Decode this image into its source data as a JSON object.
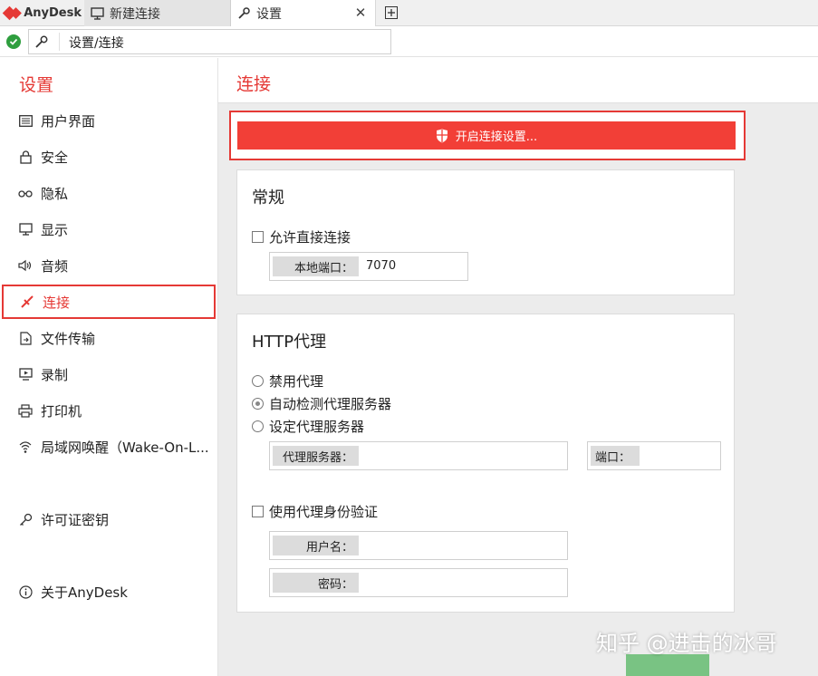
{
  "app": {
    "name": "AnyDesk"
  },
  "tabs": [
    {
      "label": "新建连接",
      "icon": "monitor-icon"
    },
    {
      "label": "设置",
      "icon": "wrench-icon"
    }
  ],
  "address": {
    "path": "设置/连接"
  },
  "sidebar": {
    "title": "设置",
    "items": [
      {
        "label": "用户界面",
        "icon": "ui-icon"
      },
      {
        "label": "安全",
        "icon": "lock-icon"
      },
      {
        "label": "隐私",
        "icon": "glasses-icon"
      },
      {
        "label": "显示",
        "icon": "display-icon"
      },
      {
        "label": "音频",
        "icon": "speaker-icon"
      },
      {
        "label": "连接",
        "icon": "connection-icon"
      },
      {
        "label": "文件传输",
        "icon": "file-transfer-icon"
      },
      {
        "label": "录制",
        "icon": "recording-icon"
      },
      {
        "label": "打印机",
        "icon": "printer-icon"
      },
      {
        "label": "局域网唤醒（Wake-On-L...",
        "icon": "wifi-icon"
      },
      {
        "label": "许可证密钥",
        "icon": "key-icon"
      },
      {
        "label": "关于AnyDesk",
        "icon": "info-icon"
      }
    ],
    "active_index": 5
  },
  "main": {
    "title": "连接",
    "unlock_button": "开启连接设置...",
    "general": {
      "title": "常规",
      "allow_direct": "允许直接连接",
      "local_port_label": "本地端口：",
      "local_port_value": "7070"
    },
    "proxy": {
      "title": "HTTP代理",
      "options": [
        "禁用代理",
        "自动检测代理服务器",
        "设定代理服务器"
      ],
      "selected_index": 1,
      "server_label": "代理服务器：",
      "port_label": "端口：",
      "auth_label": "使用代理身份验证",
      "username_label": "用户名：",
      "password_label": "密码："
    }
  },
  "watermark": "知乎 @进击的冰哥",
  "colors": {
    "accent": "#e53935",
    "button": "#f23f37",
    "status_ok": "#2e9e3e"
  }
}
